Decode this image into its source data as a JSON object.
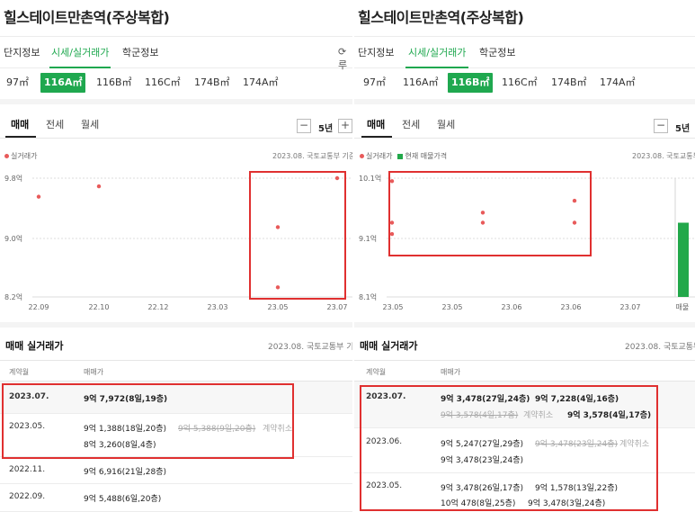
{
  "left": {
    "title": "힐스테이트만촌역(주상복합)",
    "tabs": [
      "단지정보",
      "시세/실거래가",
      "학군정보"
    ],
    "refresh": "⟳ 루",
    "sizes": [
      "97㎡",
      "116A㎡",
      "116B㎡",
      "116C㎡",
      "174B㎡",
      "174A㎡"
    ],
    "active_size": 1,
    "subtabs": [
      "매매",
      "전세",
      "월세"
    ],
    "period": "5년",
    "minus": "−",
    "plus": "+",
    "legend_actual": "실거래가",
    "basis": "2023.08. 국토교통부 기준",
    "section_title": "매매 실거래가",
    "section_basis": "2023.08. 국토교통부 기준",
    "col_month": "계약월",
    "col_price": "매매가",
    "rows": [
      {
        "month": "2023.07.",
        "line1": [
          "9억 7,972(8일,19층)"
        ],
        "line2": []
      },
      {
        "month": "2023.05.",
        "line1": [
          "9억 1,388(18일,20층)",
          "9억 5,388(9일,20층)",
          "계약취소"
        ],
        "line2": [
          "8억 3,260(8일,4층)"
        ]
      },
      {
        "month": "2022.11.",
        "line1": [
          "9억 6,916(21일,28층)"
        ],
        "line2": []
      },
      {
        "month": "2022.09.",
        "line1": [
          "9억 5,488(6일,20층)"
        ],
        "line2": []
      }
    ]
  },
  "right": {
    "title": "힐스테이트만촌역(주상복합)",
    "tabs": [
      "단지정보",
      "시세/실거래가",
      "학군정보"
    ],
    "sizes": [
      "97㎡",
      "116A㎡",
      "116B㎡",
      "116C㎡",
      "174B㎡",
      "174A㎡"
    ],
    "active_size": 2,
    "subtabs": [
      "매매",
      "전세",
      "월세"
    ],
    "period": "5년",
    "minus": "−",
    "legend_actual": "실거래가",
    "legend_listing": "현재 매물가격",
    "basis": "2023.08. 국토교통부",
    "listing_axis": "매물",
    "section_title": "매매 실거래가",
    "section_basis": "2023.08. 국토교통부",
    "col_month": "계약월",
    "col_price": "매매가",
    "rows": [
      {
        "month": "2023.07.",
        "line1": [
          "9억 3,478(27일,24층)",
          "9억 7,228(4일,16층)"
        ],
        "line2": [
          "9억 3,578(4일,17층)",
          "계약취소",
          "9억 3,578(4일,17층)"
        ]
      },
      {
        "month": "2023.06.",
        "line1": [
          "9억 5,247(27일,29층)",
          "9억 3,478(23일,24층)",
          "계약취소"
        ],
        "line2": [
          "9억 3,478(23일,24층)"
        ]
      },
      {
        "month": "2023.05.",
        "line1": [
          "9억 3,478(26일,17층)",
          "9억 1,578(13일,22층)"
        ],
        "line2": [
          "10억 478(8일,25층)",
          "9억 3,478(3일,24층)"
        ]
      }
    ]
  },
  "chart_data": [
    {
      "type": "scatter",
      "title": "",
      "xlabel": "",
      "ylabel": "",
      "x_ticks": [
        "22.09",
        "22.10",
        "22.12",
        "23.03",
        "23.05",
        "23.07"
      ],
      "y_ticks": [
        "8.2억",
        "9.0억",
        "9.8억"
      ],
      "ylim": [
        8.2,
        9.8
      ],
      "series": [
        {
          "values": [
            {
              "x": "2022.09",
              "y": 9.55
            },
            {
              "x": "2022.11",
              "y": 9.69
            },
            {
              "x": "2023.05",
              "y": 9.14
            },
            {
              "x": "2023.05",
              "y": 8.33
            },
            {
              "x": "2023.07",
              "y": 9.8
            }
          ]
        }
      ]
    },
    {
      "type": "scatter",
      "title": "",
      "xlabel": "",
      "ylabel": "",
      "x_ticks": [
        "23.05",
        "23.05",
        "23.06",
        "23.06",
        "23.07",
        "매물"
      ],
      "y_ticks": [
        "8.1억",
        "9.1억",
        "10.1억"
      ],
      "ylim": [
        8.1,
        10.1
      ],
      "series": [
        {
          "values": [
            {
              "x": "2023.05",
              "y": 10.05
            },
            {
              "x": "2023.05",
              "y": 9.35
            },
            {
              "x": "2023.05",
              "y": 9.16
            },
            {
              "x": "2023.06",
              "y": 9.52
            },
            {
              "x": "2023.06",
              "y": 9.35
            },
            {
              "x": "2023.07",
              "y": 9.72
            },
            {
              "x": "2023.07",
              "y": 9.35
            }
          ]
        }
      ]
    }
  ],
  "colors": {
    "accent": "#1fa84f",
    "point": "#e85a5a",
    "highlight": "#e03030",
    "listing_bar": "#22a84a"
  }
}
